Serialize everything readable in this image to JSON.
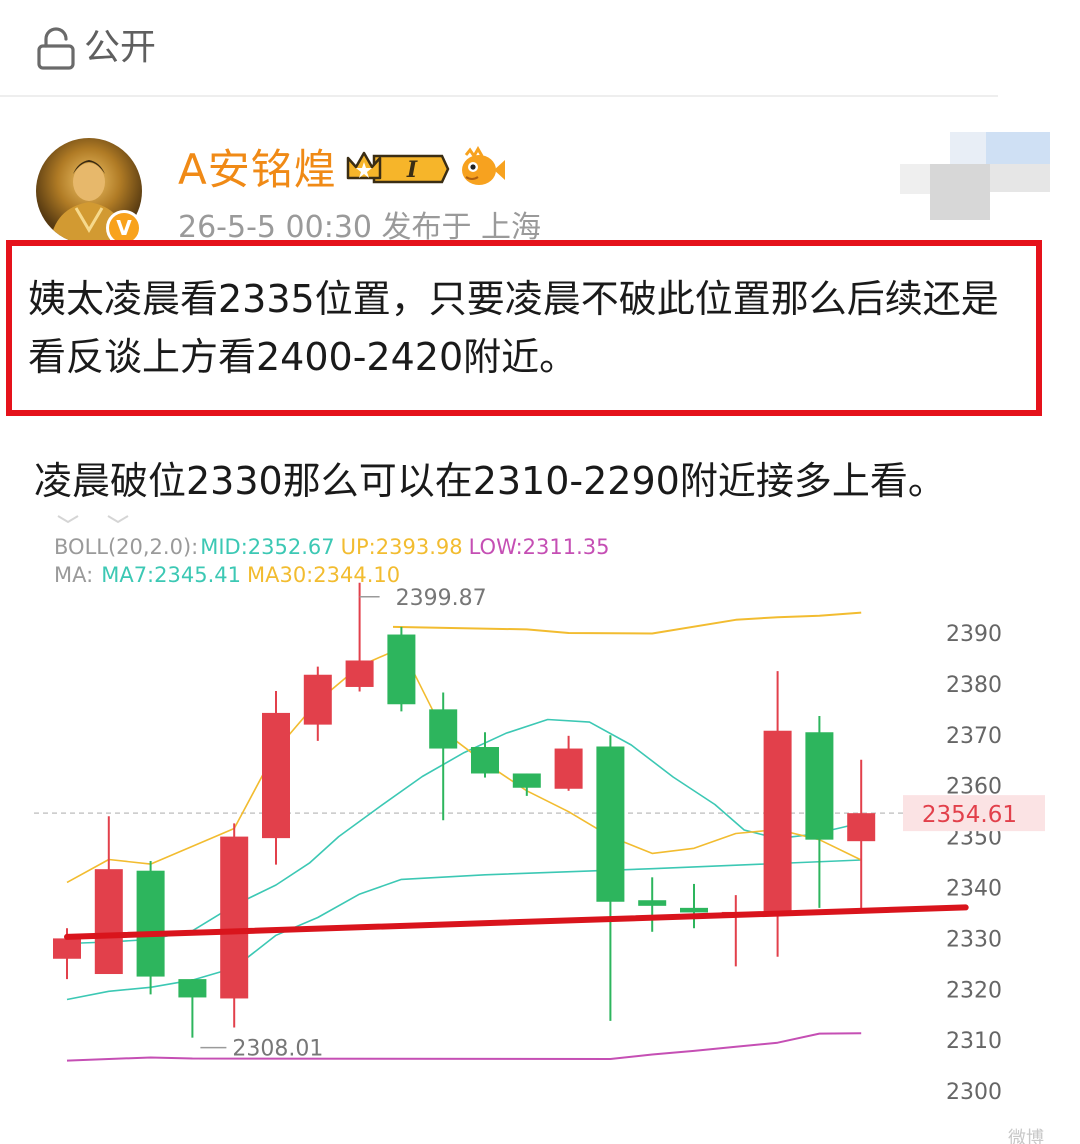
{
  "header": {
    "visibility_label": "公开"
  },
  "post": {
    "author": "A安铭煌",
    "crown_level": "I",
    "meta": "26-5-5 00:30  发布于 上海",
    "highlight_text": "姨太凌晨看2335位置，只要凌晨不破此位置那么后续还是看反谈上方看2400-2420附近。",
    "body_text": "凌晨破位2330那么可以在2310-2290附近接多上看。"
  },
  "indicators": {
    "boll_label": "BOLL(20,2.0):",
    "boll_mid": "MID:2352.67",
    "boll_up": "UP:2393.98",
    "boll_low": "LOW:2311.35",
    "ma_label": "MA:",
    "ma7": "MA7:2345.41",
    "ma30": "MA30:2344.10",
    "colors": {
      "label": "#9a9a9a",
      "mid": "#3cc8b4",
      "up": "#f2bc30",
      "low": "#c54fb4"
    }
  },
  "chart_data": {
    "type": "candlestick",
    "title": "",
    "ylim": [
      2296,
      2397
    ],
    "y_ticks": [
      "2390",
      "2380",
      "2370",
      "2360",
      "2350",
      "2340",
      "2330",
      "2320",
      "2310",
      "2300"
    ],
    "current_price_label": "2354.61",
    "current_price": 2354.61,
    "high_label": "2399.87",
    "low_label": "2308.01",
    "colors": {
      "up": "#e2404b",
      "down": "#2db55d",
      "boll_up": "#f2bc30",
      "boll_mid": "#3cc8b4",
      "boll_low": "#c54fb4",
      "ma7": "#3cc8b4",
      "ma30": "#f2bc30",
      "annotation": "#d9141c"
    },
    "candles": [
      {
        "open": 2326.0,
        "close": 2330.0,
        "high": 2332.0,
        "low": 2322.0
      },
      {
        "open": 2323.0,
        "close": 2343.6,
        "high": 2354.0,
        "low": 2323.0
      },
      {
        "open": 2343.3,
        "close": 2322.5,
        "high": 2345.2,
        "low": 2319.0
      },
      {
        "open": 2322.0,
        "close": 2318.4,
        "high": 2322.0,
        "low": 2310.5
      },
      {
        "open": 2318.2,
        "close": 2350.0,
        "high": 2352.6,
        "low": 2312.5
      },
      {
        "open": 2349.7,
        "close": 2374.3,
        "high": 2378.6,
        "low": 2344.5
      },
      {
        "open": 2372.0,
        "close": 2381.8,
        "high": 2383.4,
        "low": 2368.8
      },
      {
        "open": 2379.4,
        "close": 2384.6,
        "high": 2399.87,
        "low": 2378.5
      },
      {
        "open": 2389.7,
        "close": 2376.0,
        "high": 2391.2,
        "low": 2374.6
      },
      {
        "open": 2375.0,
        "close": 2367.3,
        "high": 2378.3,
        "low": 2353.2
      },
      {
        "open": 2367.6,
        "close": 2362.4,
        "high": 2370.5,
        "low": 2361.6
      },
      {
        "open": 2362.4,
        "close": 2359.6,
        "high": 2362.4,
        "low": 2358.0
      },
      {
        "open": 2359.4,
        "close": 2367.3,
        "high": 2369.8,
        "low": 2359.0
      },
      {
        "open": 2367.7,
        "close": 2337.2,
        "high": 2369.9,
        "low": 2313.8
      },
      {
        "open": 2337.5,
        "close": 2336.4,
        "high": 2342.0,
        "low": 2331.3
      },
      {
        "open": 2336.0,
        "close": 2335.1,
        "high": 2340.7,
        "low": 2332.0
      },
      {
        "open": 2334.7,
        "close": 2335.2,
        "high": 2338.5,
        "low": 2324.5
      },
      {
        "open": 2335.2,
        "close": 2370.8,
        "high": 2382.5,
        "low": 2326.4
      },
      {
        "open": 2370.5,
        "close": 2349.4,
        "high": 2373.7,
        "low": 2336.0
      },
      {
        "open": 2349.1,
        "close": 2354.6,
        "high": 2365.1,
        "low": 2335.8
      }
    ],
    "boll_up": [
      2391.2,
      2390.7,
      2390.0,
      2389.9,
      2392.6,
      2393.1,
      2393.4,
      2394.0
    ],
    "boll_up_x": [
      7.8,
      11,
      12,
      14,
      16,
      17,
      18,
      19
    ],
    "boll_mid": [
      2329,
      2329.3,
      2329.8,
      2331.5,
      2336.5,
      2340.5,
      2344.8,
      2350,
      2356,
      2361.8,
      2366.5,
      2370.3,
      2373,
      2372.5,
      2368,
      2361.7,
      2356.3,
      2351.3,
      2349.6,
      2350.4,
      2351.7,
      2352.7
    ],
    "boll_mid_x": [
      0,
      1,
      2,
      3,
      4,
      5,
      5.8,
      6.5,
      7.5,
      8.5,
      9.5,
      10.5,
      11.5,
      12.5,
      13.5,
      14.5,
      15.5,
      16.2,
      17,
      17.8,
      18.5,
      19
    ],
    "boll_low": [
      2306,
      2306.3,
      2306.6,
      2306.4,
      2306.3,
      2307.2,
      2307.9,
      2308.7,
      2309.5,
      2311.3,
      2311.35
    ],
    "boll_low_x": [
      0,
      1,
      2,
      3,
      13,
      14,
      15,
      16,
      17,
      18,
      19
    ],
    "ma7": [
      2318,
      2319.6,
      2320.4,
      2321.8,
      2324.2,
      2330.6,
      2334.1,
      2338.7,
      2341.6,
      2342.5,
      2343.7,
      2345.4
    ],
    "ma7_x": [
      0,
      1,
      2,
      3,
      4,
      5,
      6,
      7,
      8,
      10,
      14,
      19
    ],
    "ma30": [
      2341.0,
      2345.5,
      2344.6,
      2351.6,
      2367.0,
      2376.6,
      2383.5,
      2387.1,
      2370.7,
      2364.5,
      2359.0,
      2354.9,
      2350.0,
      2346.7,
      2347.7,
      2350.6,
      2351.4,
      2349.4,
      2345.41
    ],
    "ma30_x": [
      0,
      1,
      2,
      4,
      5,
      6,
      7,
      8,
      9,
      10,
      11,
      12,
      13,
      14,
      15,
      16,
      17,
      18,
      19
    ],
    "support_line": [
      2330.3,
      2336.1
    ],
    "support_line_x": [
      0,
      21.5
    ]
  },
  "watermark": "微博"
}
